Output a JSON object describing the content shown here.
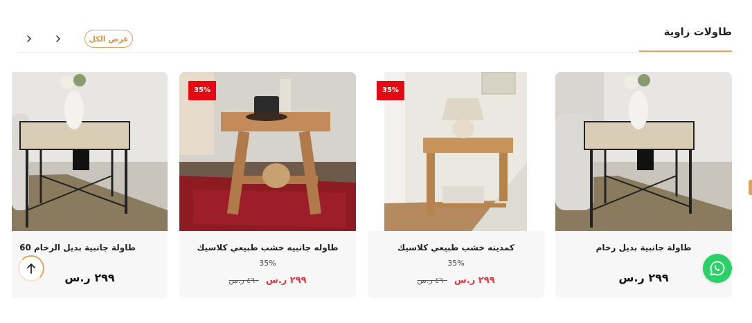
{
  "section": {
    "title": "طاولات زاوية",
    "view_all": "عرض الكل"
  },
  "nav": {
    "prev_icon": "chevron-right-icon",
    "next_icon": "chevron-right-icon"
  },
  "products": [
    {
      "name": "طاولة جانبية بديل رخام",
      "price": "٢٩٩ ر.س"
    },
    {
      "name": "كمدينه خشب طبيعي كلاسيك",
      "badge": "35%",
      "discount": "35%",
      "sale_price": "٢٩٩ ر.س",
      "old_price": "٤٦٠ ر.س"
    },
    {
      "name": "طاوله جانبيه خشب طبيعي كلاسيك",
      "badge": "35%",
      "discount": "35%",
      "sale_price": "٢٩٩ ر.س",
      "old_price": "٤٦٠ ر.س"
    },
    {
      "name": "طاولة جانبية بديل الرخام 60",
      "price": "٢٩٩ ر.س"
    }
  ],
  "floating": {
    "whatsapp_icon": "whatsapp-icon",
    "scroll_top_icon": "arrow-up-icon"
  },
  "colors": {
    "accent": "#e0a458",
    "sale": "#e6323a",
    "badge": "#e50914",
    "whatsapp": "#2bd066"
  }
}
